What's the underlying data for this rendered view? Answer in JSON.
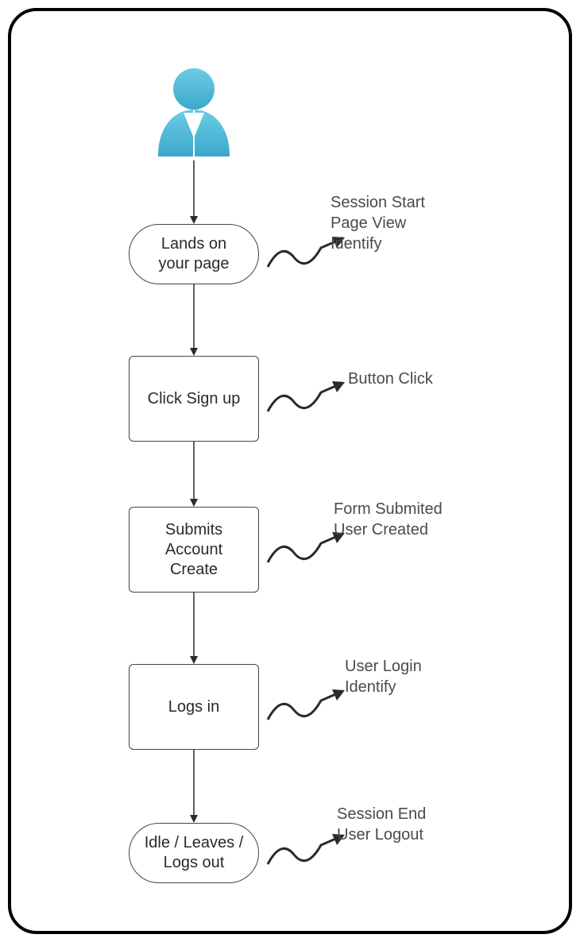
{
  "nodes": {
    "lands": "Lands on your page",
    "signup": "Click Sign up",
    "submit": "Submits Account Create",
    "login": "Logs in",
    "idle": "Idle / Leaves / Logs out"
  },
  "events": {
    "lands": "Session Start\nPage View\nIdentify",
    "signup": "Button Click",
    "submit": "Form Submited\nUser Created",
    "login": "User Login\nIdentify",
    "idle": "Session End\nUser Logout"
  }
}
